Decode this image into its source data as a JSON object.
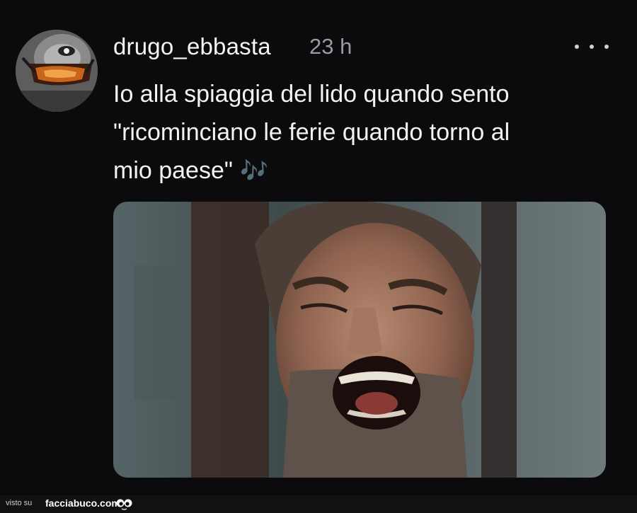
{
  "post": {
    "username": "drugo_ebbasta",
    "timestamp": "23 h",
    "caption_lines": [
      "Io alla spiaggia del lido quando sento",
      "\"ricominciano le ferie quando torno al",
      "mio paese\""
    ],
    "emoji": "🎶",
    "more_icon": "ellipsis-icon"
  },
  "footer": {
    "visto_su": "visto su",
    "site": "facciabuco.com",
    "logo_icon": "googly-eyes-icon"
  },
  "colors": {
    "background": "#0b0b0d",
    "text": "#f3f3f3",
    "muted": "#9a9a9f",
    "emoji": "#a24fe0"
  }
}
